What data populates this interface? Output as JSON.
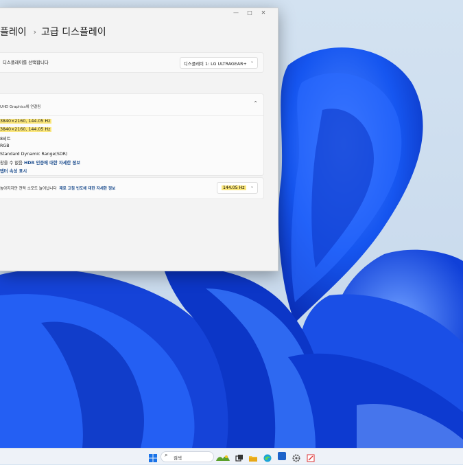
{
  "window": {
    "controls": {
      "minimize": "—",
      "maximize": "□",
      "close": "✕"
    },
    "breadcrumb": {
      "parent": "플레이",
      "separator": "›",
      "current": "고급 디스플레이"
    }
  },
  "display_select": {
    "label": "디스플레이를 선택합니다",
    "dropdown_value": "디스플레이 1: LG ULTRAGEAR+",
    "chevron": "⌄"
  },
  "display_info": {
    "header": "UHD Graphics에 연결됨",
    "collapse_icon": "⌃",
    "lines": [
      "3840×2160, 144.05 Hz",
      "3840×2160, 144.05 Hz",
      "8비트",
      "RGB",
      "Standard Dynamic Range(SDR)"
    ],
    "hdr_prefix": "창을 수 없음",
    "hdr_link": "HDR 인증에 대한 자세한 정보",
    "adapter_link": "댑터 속성 표시"
  },
  "refresh_rate": {
    "description": "높아지지만 전력 소모도 늘어납니다",
    "link": "재로 고침 빈도에 대한 자세한 정보",
    "value": "144.05 Hz",
    "chevron": "⌄"
  },
  "taskbar": {
    "search_placeholder": "검색",
    "search_icon": "search-icon",
    "icons": [
      "windows-start-icon",
      "widgets-icon",
      "task-view-icon",
      "file-explorer-icon",
      "edge-browser-icon",
      "store-icon",
      "terminal-icon",
      "settings-gear-icon",
      "snipping-tool-icon"
    ]
  },
  "colors": {
    "highlight": "#fbe77c",
    "link": "#1f4f8f",
    "wallpaper_blue": "#1146e8"
  }
}
